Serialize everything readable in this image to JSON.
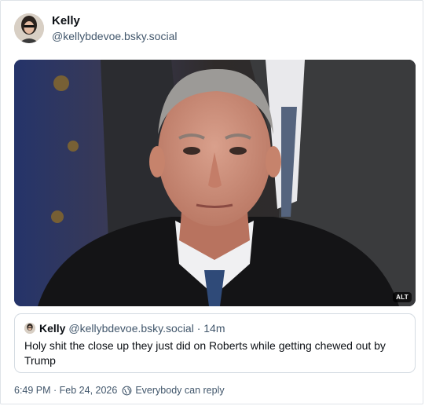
{
  "post": {
    "author_name": "Kelly",
    "author_handle": "@kellybdevoe.bsky.social",
    "media_alt_badge": "ALT",
    "timestamp": "6:49 PM · Feb 24, 2026",
    "reply_setting": "Everybody can reply"
  },
  "quoted_post": {
    "author_name": "Kelly",
    "author_handle": "@kellybdevoe.bsky.social",
    "time_ago": "· 14m",
    "text": "Holy shit the close up they just did on Roberts while getting chewed out by Trump"
  },
  "icons": {
    "reply_setting": "globe-icon"
  }
}
